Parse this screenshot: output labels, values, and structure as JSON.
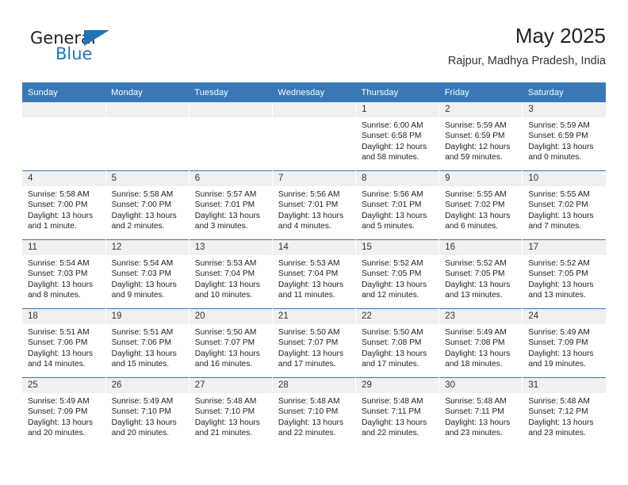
{
  "brand": {
    "name_top": "General",
    "name_bottom": "Blue",
    "triangle_icon": "triangle-icon",
    "accent_color": "#1e74bb"
  },
  "header": {
    "title": "May 2025",
    "subtitle": "Rajpur, Madhya Pradesh, India"
  },
  "theme": {
    "header_blue": "#3a78b5",
    "daynum_strip": "#f0f0f0",
    "text": "#222222"
  },
  "calendar": {
    "day_headers": [
      "Sunday",
      "Monday",
      "Tuesday",
      "Wednesday",
      "Thursday",
      "Friday",
      "Saturday"
    ],
    "weeks": [
      [
        {
          "day": "",
          "sunrise": "",
          "sunset": "",
          "daylight_line1": "",
          "daylight_line2": ""
        },
        {
          "day": "",
          "sunrise": "",
          "sunset": "",
          "daylight_line1": "",
          "daylight_line2": ""
        },
        {
          "day": "",
          "sunrise": "",
          "sunset": "",
          "daylight_line1": "",
          "daylight_line2": ""
        },
        {
          "day": "",
          "sunrise": "",
          "sunset": "",
          "daylight_line1": "",
          "daylight_line2": ""
        },
        {
          "day": "1",
          "sunrise": "Sunrise: 6:00 AM",
          "sunset": "Sunset: 6:58 PM",
          "daylight_line1": "Daylight: 12 hours",
          "daylight_line2": "and 58 minutes."
        },
        {
          "day": "2",
          "sunrise": "Sunrise: 5:59 AM",
          "sunset": "Sunset: 6:59 PM",
          "daylight_line1": "Daylight: 12 hours",
          "daylight_line2": "and 59 minutes."
        },
        {
          "day": "3",
          "sunrise": "Sunrise: 5:59 AM",
          "sunset": "Sunset: 6:59 PM",
          "daylight_line1": "Daylight: 13 hours",
          "daylight_line2": "and 0 minutes."
        }
      ],
      [
        {
          "day": "4",
          "sunrise": "Sunrise: 5:58 AM",
          "sunset": "Sunset: 7:00 PM",
          "daylight_line1": "Daylight: 13 hours",
          "daylight_line2": "and 1 minute."
        },
        {
          "day": "5",
          "sunrise": "Sunrise: 5:58 AM",
          "sunset": "Sunset: 7:00 PM",
          "daylight_line1": "Daylight: 13 hours",
          "daylight_line2": "and 2 minutes."
        },
        {
          "day": "6",
          "sunrise": "Sunrise: 5:57 AM",
          "sunset": "Sunset: 7:01 PM",
          "daylight_line1": "Daylight: 13 hours",
          "daylight_line2": "and 3 minutes."
        },
        {
          "day": "7",
          "sunrise": "Sunrise: 5:56 AM",
          "sunset": "Sunset: 7:01 PM",
          "daylight_line1": "Daylight: 13 hours",
          "daylight_line2": "and 4 minutes."
        },
        {
          "day": "8",
          "sunrise": "Sunrise: 5:56 AM",
          "sunset": "Sunset: 7:01 PM",
          "daylight_line1": "Daylight: 13 hours",
          "daylight_line2": "and 5 minutes."
        },
        {
          "day": "9",
          "sunrise": "Sunrise: 5:55 AM",
          "sunset": "Sunset: 7:02 PM",
          "daylight_line1": "Daylight: 13 hours",
          "daylight_line2": "and 6 minutes."
        },
        {
          "day": "10",
          "sunrise": "Sunrise: 5:55 AM",
          "sunset": "Sunset: 7:02 PM",
          "daylight_line1": "Daylight: 13 hours",
          "daylight_line2": "and 7 minutes."
        }
      ],
      [
        {
          "day": "11",
          "sunrise": "Sunrise: 5:54 AM",
          "sunset": "Sunset: 7:03 PM",
          "daylight_line1": "Daylight: 13 hours",
          "daylight_line2": "and 8 minutes."
        },
        {
          "day": "12",
          "sunrise": "Sunrise: 5:54 AM",
          "sunset": "Sunset: 7:03 PM",
          "daylight_line1": "Daylight: 13 hours",
          "daylight_line2": "and 9 minutes."
        },
        {
          "day": "13",
          "sunrise": "Sunrise: 5:53 AM",
          "sunset": "Sunset: 7:04 PM",
          "daylight_line1": "Daylight: 13 hours",
          "daylight_line2": "and 10 minutes."
        },
        {
          "day": "14",
          "sunrise": "Sunrise: 5:53 AM",
          "sunset": "Sunset: 7:04 PM",
          "daylight_line1": "Daylight: 13 hours",
          "daylight_line2": "and 11 minutes."
        },
        {
          "day": "15",
          "sunrise": "Sunrise: 5:52 AM",
          "sunset": "Sunset: 7:05 PM",
          "daylight_line1": "Daylight: 13 hours",
          "daylight_line2": "and 12 minutes."
        },
        {
          "day": "16",
          "sunrise": "Sunrise: 5:52 AM",
          "sunset": "Sunset: 7:05 PM",
          "daylight_line1": "Daylight: 13 hours",
          "daylight_line2": "and 13 minutes."
        },
        {
          "day": "17",
          "sunrise": "Sunrise: 5:52 AM",
          "sunset": "Sunset: 7:05 PM",
          "daylight_line1": "Daylight: 13 hours",
          "daylight_line2": "and 13 minutes."
        }
      ],
      [
        {
          "day": "18",
          "sunrise": "Sunrise: 5:51 AM",
          "sunset": "Sunset: 7:06 PM",
          "daylight_line1": "Daylight: 13 hours",
          "daylight_line2": "and 14 minutes."
        },
        {
          "day": "19",
          "sunrise": "Sunrise: 5:51 AM",
          "sunset": "Sunset: 7:06 PM",
          "daylight_line1": "Daylight: 13 hours",
          "daylight_line2": "and 15 minutes."
        },
        {
          "day": "20",
          "sunrise": "Sunrise: 5:50 AM",
          "sunset": "Sunset: 7:07 PM",
          "daylight_line1": "Daylight: 13 hours",
          "daylight_line2": "and 16 minutes."
        },
        {
          "day": "21",
          "sunrise": "Sunrise: 5:50 AM",
          "sunset": "Sunset: 7:07 PM",
          "daylight_line1": "Daylight: 13 hours",
          "daylight_line2": "and 17 minutes."
        },
        {
          "day": "22",
          "sunrise": "Sunrise: 5:50 AM",
          "sunset": "Sunset: 7:08 PM",
          "daylight_line1": "Daylight: 13 hours",
          "daylight_line2": "and 17 minutes."
        },
        {
          "day": "23",
          "sunrise": "Sunrise: 5:49 AM",
          "sunset": "Sunset: 7:08 PM",
          "daylight_line1": "Daylight: 13 hours",
          "daylight_line2": "and 18 minutes."
        },
        {
          "day": "24",
          "sunrise": "Sunrise: 5:49 AM",
          "sunset": "Sunset: 7:09 PM",
          "daylight_line1": "Daylight: 13 hours",
          "daylight_line2": "and 19 minutes."
        }
      ],
      [
        {
          "day": "25",
          "sunrise": "Sunrise: 5:49 AM",
          "sunset": "Sunset: 7:09 PM",
          "daylight_line1": "Daylight: 13 hours",
          "daylight_line2": "and 20 minutes."
        },
        {
          "day": "26",
          "sunrise": "Sunrise: 5:49 AM",
          "sunset": "Sunset: 7:10 PM",
          "daylight_line1": "Daylight: 13 hours",
          "daylight_line2": "and 20 minutes."
        },
        {
          "day": "27",
          "sunrise": "Sunrise: 5:48 AM",
          "sunset": "Sunset: 7:10 PM",
          "daylight_line1": "Daylight: 13 hours",
          "daylight_line2": "and 21 minutes."
        },
        {
          "day": "28",
          "sunrise": "Sunrise: 5:48 AM",
          "sunset": "Sunset: 7:10 PM",
          "daylight_line1": "Daylight: 13 hours",
          "daylight_line2": "and 22 minutes."
        },
        {
          "day": "29",
          "sunrise": "Sunrise: 5:48 AM",
          "sunset": "Sunset: 7:11 PM",
          "daylight_line1": "Daylight: 13 hours",
          "daylight_line2": "and 22 minutes."
        },
        {
          "day": "30",
          "sunrise": "Sunrise: 5:48 AM",
          "sunset": "Sunset: 7:11 PM",
          "daylight_line1": "Daylight: 13 hours",
          "daylight_line2": "and 23 minutes."
        },
        {
          "day": "31",
          "sunrise": "Sunrise: 5:48 AM",
          "sunset": "Sunset: 7:12 PM",
          "daylight_line1": "Daylight: 13 hours",
          "daylight_line2": "and 23 minutes."
        }
      ]
    ]
  }
}
